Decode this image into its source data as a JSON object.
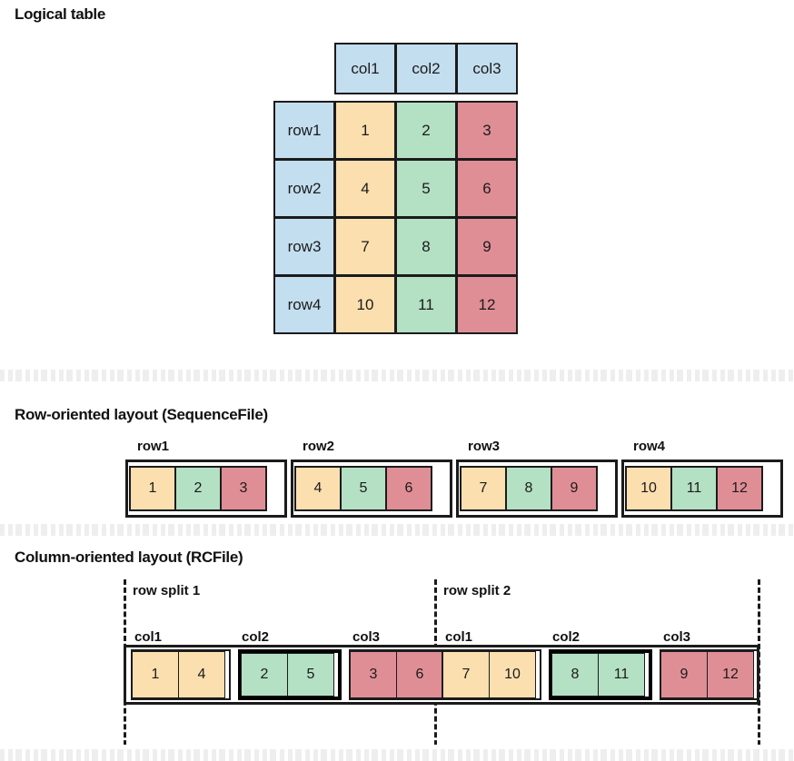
{
  "sections": {
    "logical": {
      "title": "Logical table"
    },
    "row": {
      "title": "Row-oriented layout (SequenceFile)"
    },
    "column": {
      "title": "Column-oriented layout (RCFile)"
    }
  },
  "logical_table": {
    "column_headers": [
      "col1",
      "col2",
      "col3"
    ],
    "row_headers": [
      "row1",
      "row2",
      "row3",
      "row4"
    ],
    "cells": [
      [
        "1",
        "2",
        "3"
      ],
      [
        "4",
        "5",
        "6"
      ],
      [
        "7",
        "8",
        "9"
      ],
      [
        "10",
        "11",
        "12"
      ]
    ]
  },
  "row_layout": {
    "groups": [
      {
        "label": "row1",
        "values": [
          "1",
          "2",
          "3"
        ]
      },
      {
        "label": "row2",
        "values": [
          "4",
          "5",
          "6"
        ]
      },
      {
        "label": "row3",
        "values": [
          "7",
          "8",
          "9"
        ]
      },
      {
        "label": "row4",
        "values": [
          "10",
          "11",
          "12"
        ]
      }
    ]
  },
  "column_layout": {
    "splits": [
      {
        "label": "row split 1",
        "groups": [
          {
            "label": "col1",
            "values": [
              "1",
              "4"
            ],
            "emphasis": false
          },
          {
            "label": "col2",
            "values": [
              "2",
              "5"
            ],
            "emphasis": true
          },
          {
            "label": "col3",
            "values": [
              "3",
              "6"
            ],
            "emphasis": false
          }
        ]
      },
      {
        "label": "row split 2",
        "groups": [
          {
            "label": "col1",
            "values": [
              "7",
              "10"
            ],
            "emphasis": false
          },
          {
            "label": "col2",
            "values": [
              "8",
              "11"
            ],
            "emphasis": true
          },
          {
            "label": "col3",
            "values": [
              "9",
              "12"
            ],
            "emphasis": false
          }
        ]
      }
    ]
  },
  "colors": {
    "col1": "#fbdfaf",
    "col2": "#b4e0c4",
    "col3": "#e08e96",
    "header": "#c3deef",
    "outline": "#1b1b1b",
    "background": "#ffffff",
    "stream_band": "#eeeeee"
  }
}
